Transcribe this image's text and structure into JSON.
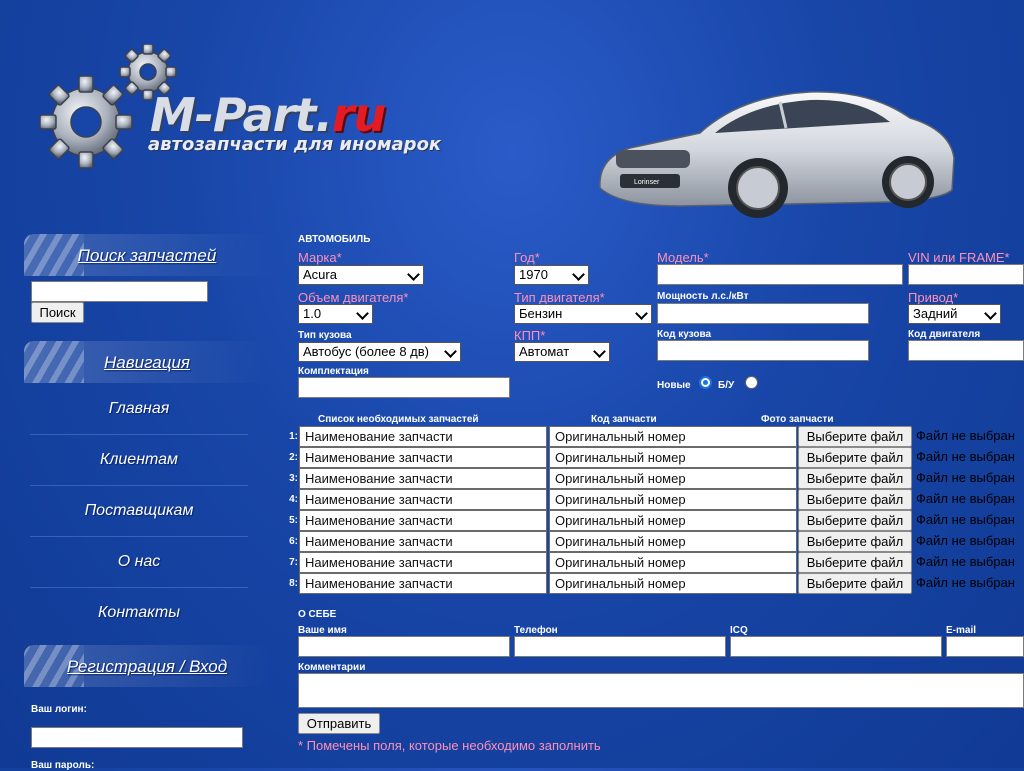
{
  "header": {
    "logo_main": "M-Part.",
    "logo_ru": "ru",
    "tagline": "автозапчасти для иномарок"
  },
  "sidebar": {
    "search_title": "Поиск запчастей",
    "search_button": "Поиск",
    "nav_title": "Навигация",
    "nav_items": [
      "Главная",
      "Клиентам",
      "Поставщикам",
      "О нас",
      "Контакты"
    ],
    "auth_title": "Регистрация / Вход",
    "login_label": "Ваш логин:",
    "password_label": "Ваш пароль:"
  },
  "car_form": {
    "section_title": "АВТОМОБИЛЬ",
    "make_label": "Марка*",
    "make_value": "Acura",
    "year_label": "Год*",
    "year_value": "1970",
    "model_label": "Модель*",
    "vin_label": "VIN или FRAME*",
    "engine_volume_label": "Объем двигателя*",
    "engine_volume_value": "1.0",
    "engine_type_label": "Тип двигателя*",
    "engine_type_value": "Бензин",
    "power_label": "Мощность л.с./кВт",
    "drive_label": "Привод*",
    "drive_value": "Задний",
    "body_type_label": "Тип кузова",
    "body_type_value": "Автобус (более 8 дв)",
    "gearbox_label": "КПП*",
    "gearbox_value": "Автомат",
    "body_code_label": "Код кузова",
    "engine_code_label": "Код двигателя",
    "equipment_label": "Комплектация",
    "new_label": "Новые",
    "used_label": "Б/У"
  },
  "parts": {
    "col_list": "Список необходимых запчастей",
    "col_code": "Код запчасти",
    "col_photo": "Фото запчасти",
    "name_placeholder": "Наименование запчасти",
    "code_placeholder": "Оригинальный номер",
    "file_button": "Выберите файл",
    "no_file": "Файл не выбран",
    "row_numbers": [
      "1:",
      "2:",
      "3:",
      "4:",
      "5:",
      "6:",
      "7:",
      "8:"
    ]
  },
  "about": {
    "section_title": "О СЕБЕ",
    "name_label": "Ваше имя",
    "phone_label": "Телефон",
    "icq_label": "ICQ",
    "email_label": "E-mail",
    "comments_label": "Комментарии",
    "submit_button": "Отправить",
    "required_note": "* Помечены поля, которые необходимо заполнить"
  }
}
